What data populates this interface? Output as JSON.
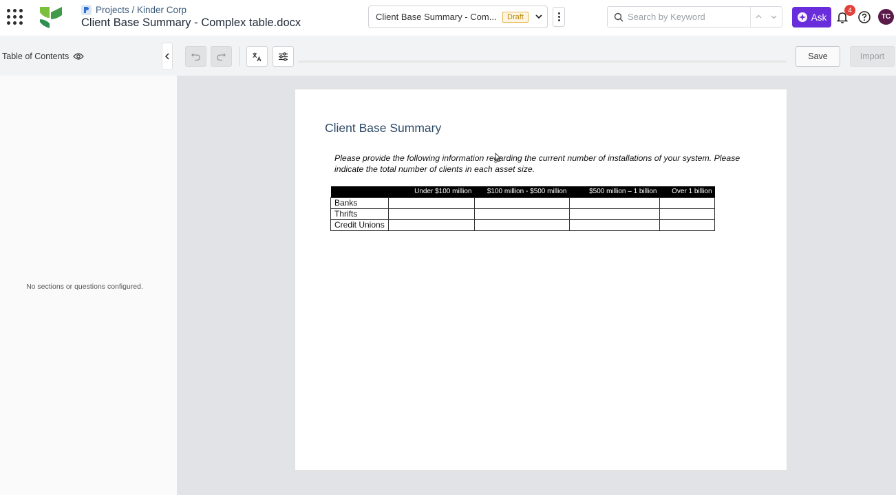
{
  "header": {
    "breadcrumb": "Projects / Kinder Corp",
    "title": "Client Base Summary - Complex table.docx",
    "version_select": {
      "selected": "Client Base Summary - Com...",
      "status_badge": "Draft"
    },
    "search": {
      "placeholder": "Search by Keyword"
    },
    "ask_label": "Ask",
    "notification_count": "4",
    "avatar_initials": "TC"
  },
  "sidebar": {
    "title": "Table of Contents",
    "empty_message": "No sections or questions configured."
  },
  "toolbar": {
    "save_label": "Save",
    "import_label": "Import"
  },
  "document": {
    "heading": "Client Base Summary",
    "paragraph": "Please provide the following information regarding the current number of installations of your system. Please indicate the total number of clients in each asset size.",
    "table": {
      "headers": [
        "",
        "Under $100 million",
        "$100 million - $500 million",
        "$500 million – 1 billion",
        "Over 1 billion"
      ],
      "rows": [
        [
          "Banks",
          "",
          "",
          "",
          ""
        ],
        [
          "Thrifts",
          "",
          "",
          "",
          ""
        ],
        [
          "Credit Unions",
          "",
          "",
          "",
          ""
        ]
      ]
    }
  },
  "colors": {
    "accent": "#6a2ddb",
    "badge": "#e0413a",
    "avatar": "#5a1a4a",
    "draft": "#e5b54b"
  },
  "icons": [
    "apps-grid-icon",
    "logo-icon",
    "project-icon",
    "chevron-down-icon",
    "kebab-icon",
    "search-icon",
    "chevron-up-icon",
    "ask-sparkle-icon",
    "bell-icon",
    "help-icon",
    "eye-icon",
    "chevron-left-icon",
    "undo-icon",
    "redo-icon",
    "translate-icon",
    "settings-sliders-icon"
  ]
}
